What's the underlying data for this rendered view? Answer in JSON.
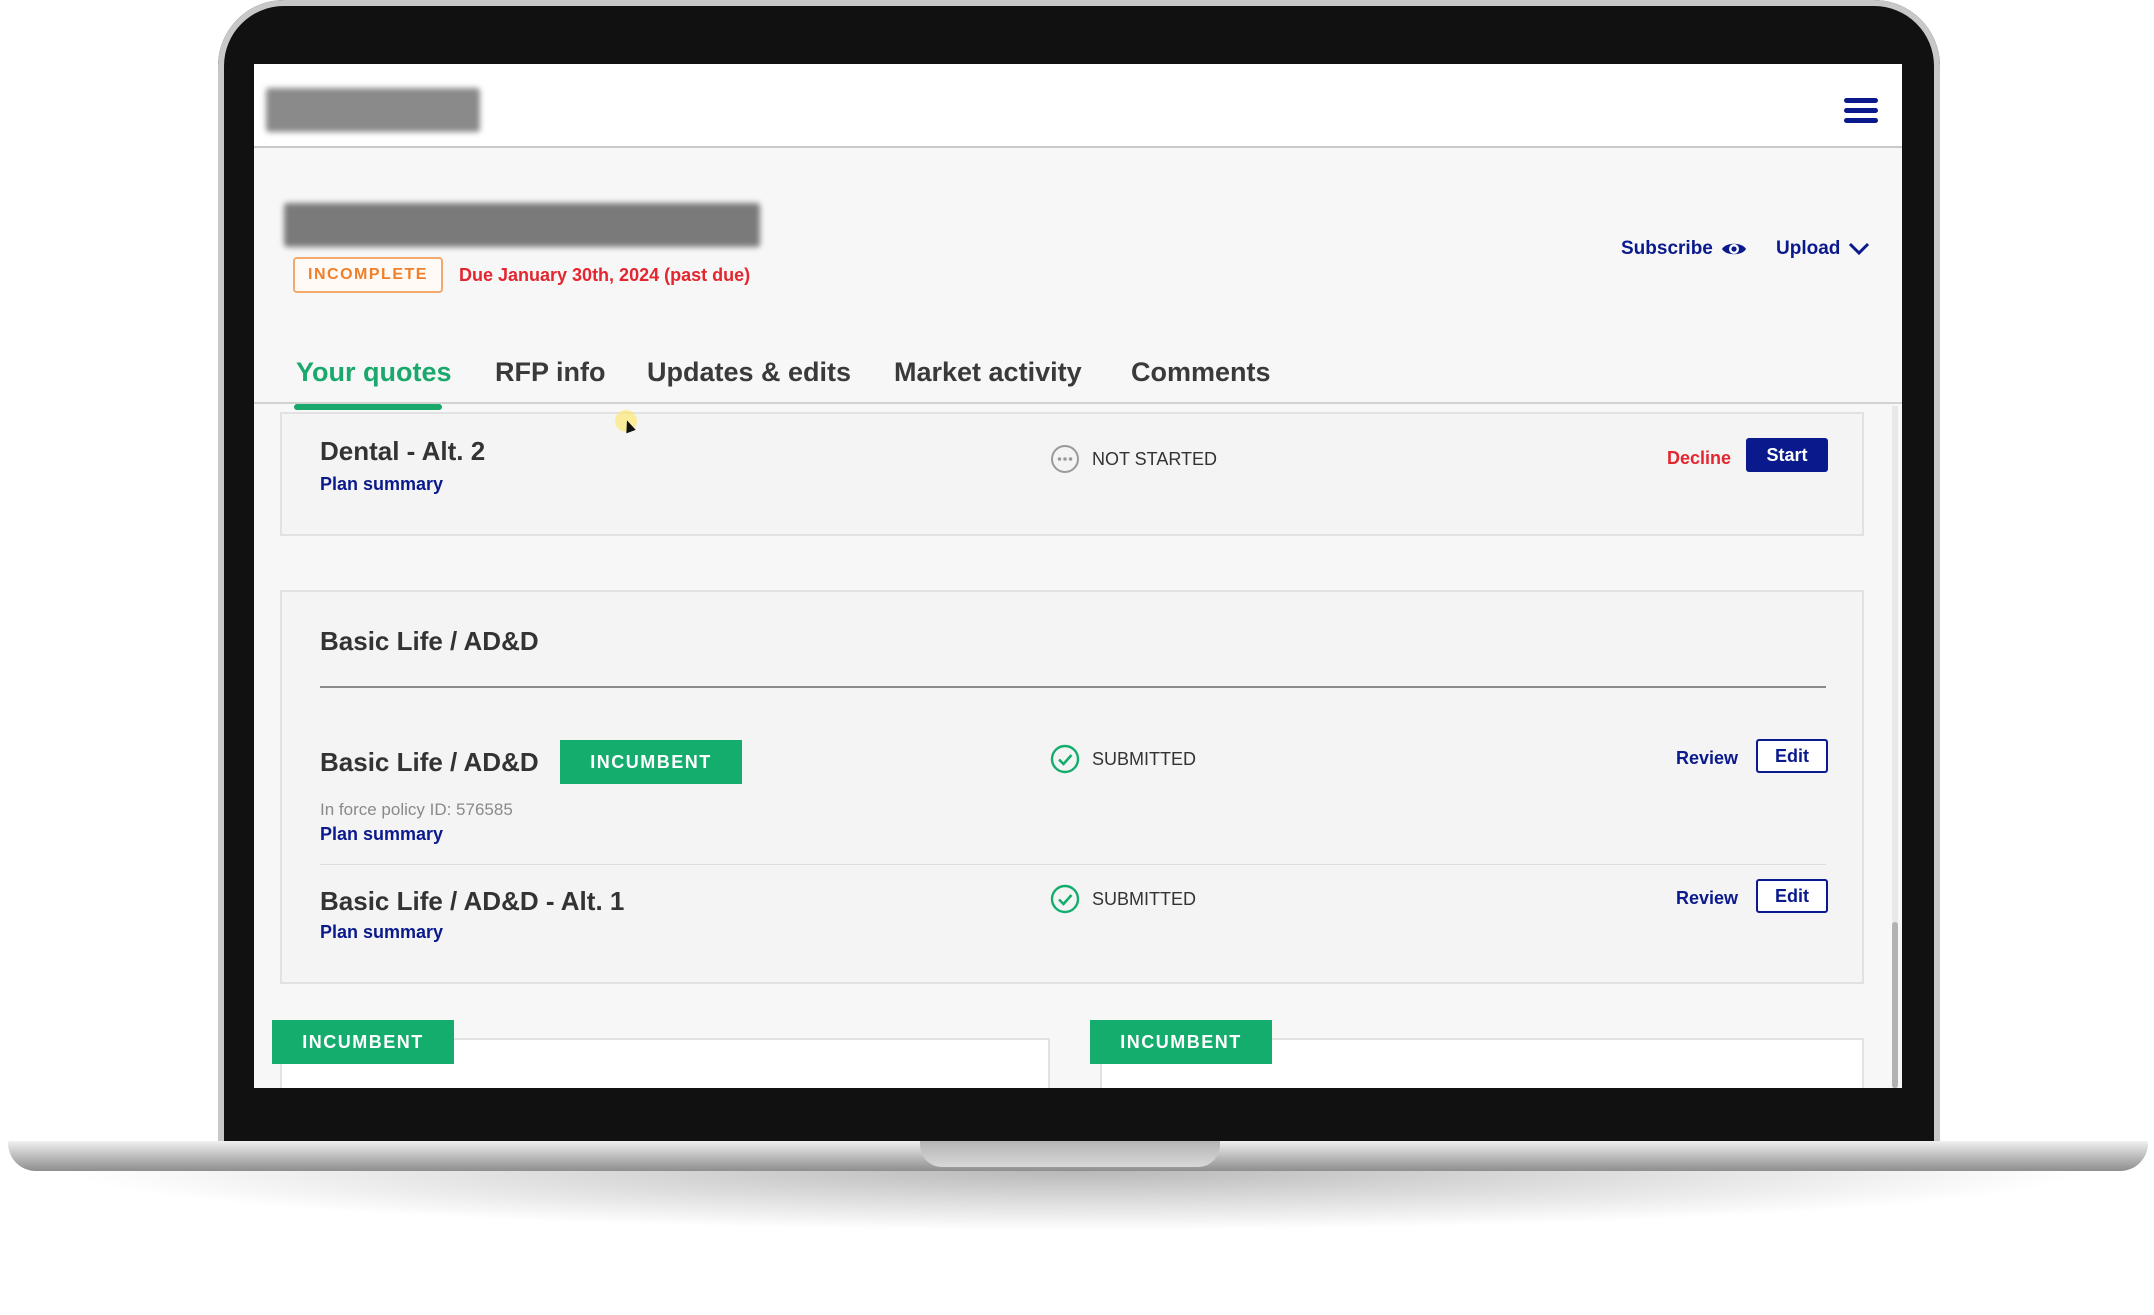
{
  "header": {
    "status_badge": "INCOMPLETE",
    "due_text": "Due January 30th, 2024 (past due)",
    "subscribe_label": "Subscribe",
    "upload_label": "Upload"
  },
  "tabs": [
    {
      "label": "Your quotes",
      "active": true
    },
    {
      "label": "RFP info",
      "active": false
    },
    {
      "label": "Updates & edits",
      "active": false
    },
    {
      "label": "Market activity",
      "active": false
    },
    {
      "label": "Comments",
      "active": false
    }
  ],
  "dental_alt2": {
    "title": "Dental - Alt. 2",
    "plan_link": "Plan summary",
    "status": "NOT STARTED",
    "decline_label": "Decline",
    "start_label": "Start"
  },
  "basic_life": {
    "section_title": "Basic Life / AD&D",
    "rows": [
      {
        "title": "Basic Life / AD&D",
        "tag": "INCUMBENT",
        "policy_id": "In force policy ID: 576585",
        "plan_link": "Plan summary",
        "status": "SUBMITTED",
        "review_label": "Review",
        "edit_label": "Edit"
      },
      {
        "title": "Basic Life / AD&D - Alt. 1",
        "plan_link": "Plan summary",
        "status": "SUBMITTED",
        "review_label": "Review",
        "edit_label": "Edit"
      }
    ]
  },
  "bottom_cards": [
    {
      "tag": "INCUMBENT"
    },
    {
      "tag": "INCUMBENT"
    }
  ],
  "colors": {
    "brand_navy": "#0a1a8c",
    "accent_green": "#1aa86c",
    "warning_orange": "#f07f2a",
    "danger_red": "#e3262f"
  }
}
